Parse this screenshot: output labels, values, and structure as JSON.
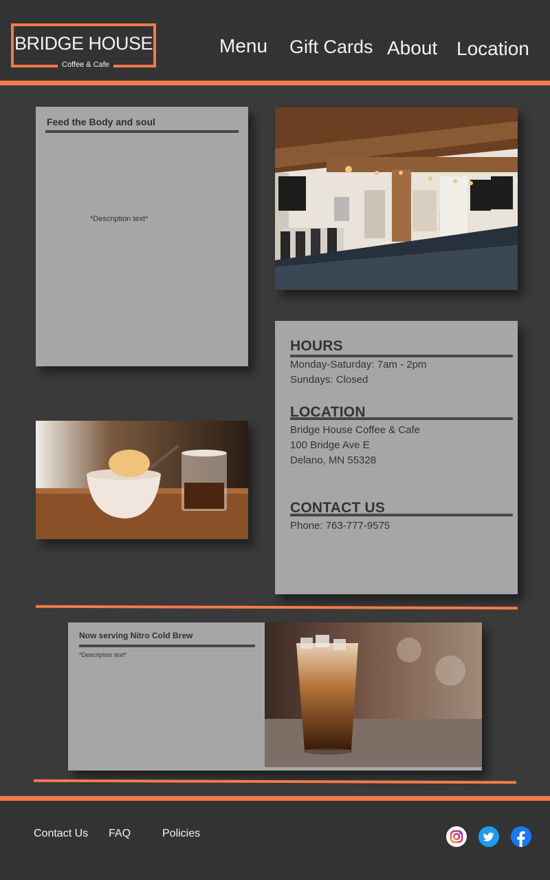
{
  "brand": {
    "name": "BRIDGE HOUSE",
    "tagline": "Coffee & Cafe",
    "accent_color": "#f47a4a"
  },
  "nav": {
    "items": [
      {
        "label": "Menu"
      },
      {
        "label": "Gift Cards"
      },
      {
        "label": "About"
      },
      {
        "label": "Location"
      }
    ]
  },
  "feature_card": {
    "title": "Feed the Body and soul",
    "description": "*Description text*"
  },
  "info_card": {
    "hours": {
      "title": "HOURS",
      "lines": [
        "Monday-Saturday: 7am - 2pm",
        "Sundays: Closed"
      ]
    },
    "location": {
      "title": "LOCATION",
      "lines": [
        "Bridge House Coffee & Cafe",
        "100 Bridge Ave E",
        "Delano, MN 55328"
      ]
    },
    "contact": {
      "title": "CONTACT US",
      "lines": [
        "Phone: 763-777-9575"
      ]
    }
  },
  "promo_card": {
    "title": "Now serving Nitro Cold Brew",
    "description": "*Description text*"
  },
  "footer": {
    "links": [
      {
        "label": "Contact Us"
      },
      {
        "label": "FAQ"
      },
      {
        "label": "Policies"
      }
    ],
    "social": [
      "instagram-icon",
      "twitter-icon",
      "facebook-icon"
    ]
  }
}
